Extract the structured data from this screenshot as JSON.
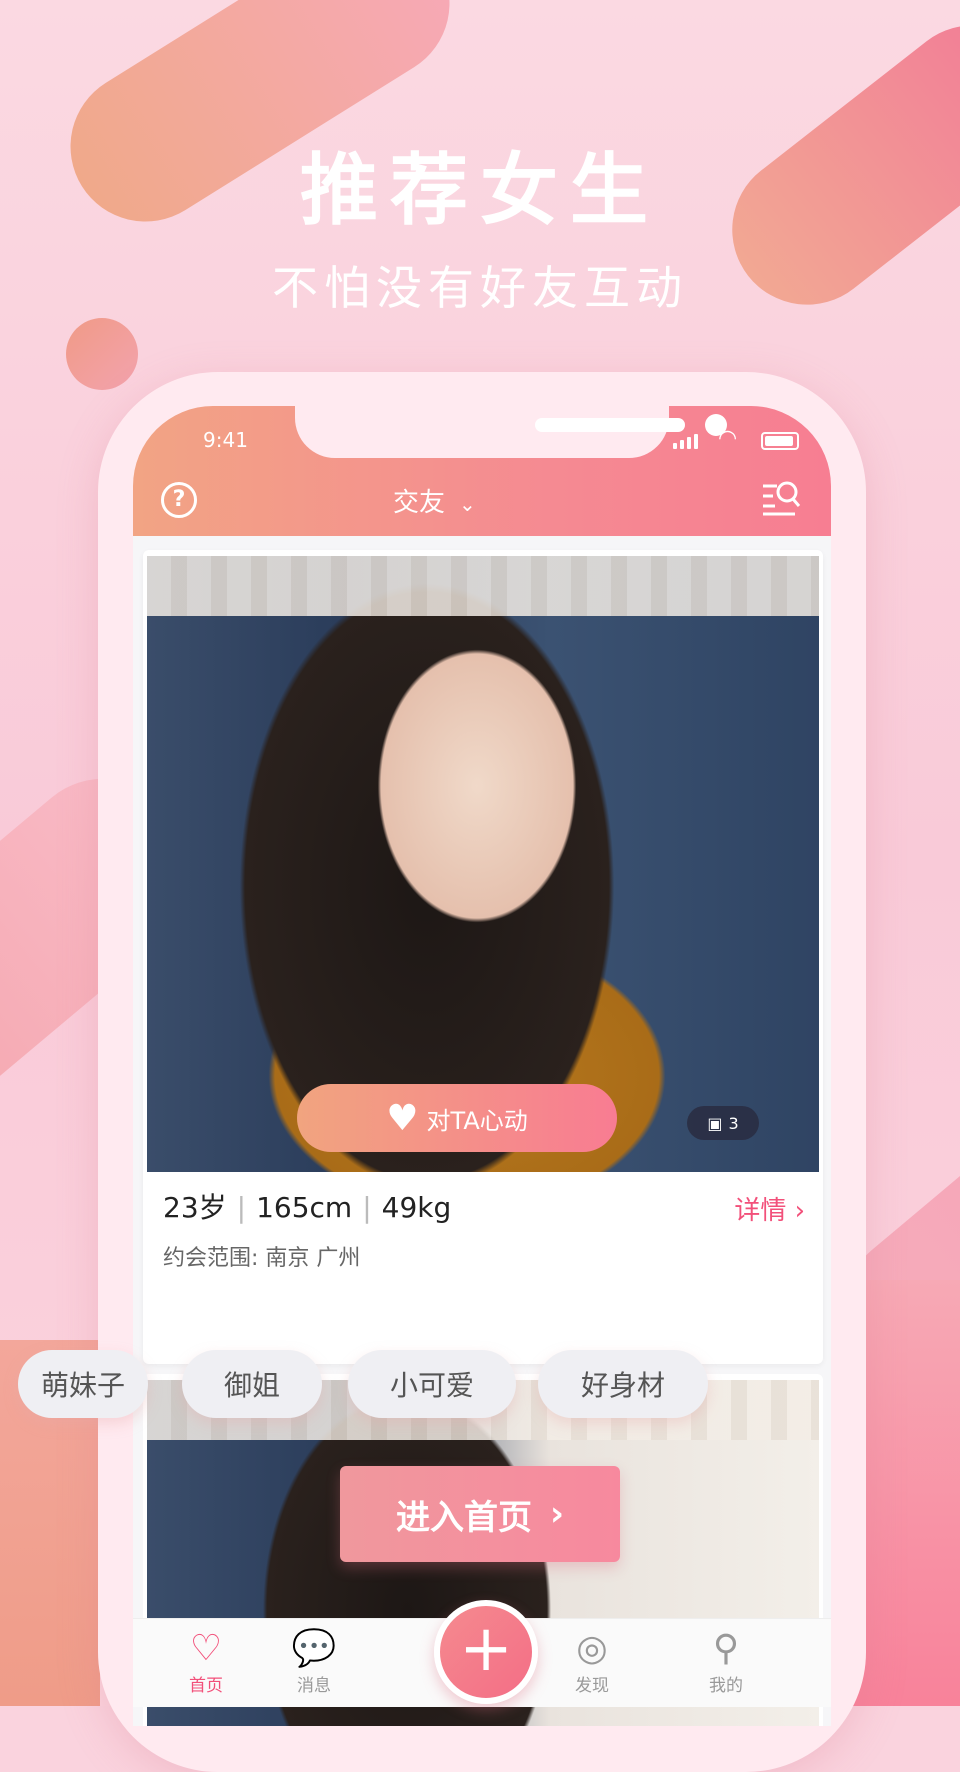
{
  "promo": {
    "headline": "推荐女生",
    "subheadline": "不怕没有好友互动"
  },
  "status_bar": {
    "time": "9:41"
  },
  "nav": {
    "title": "交友",
    "help_icon": "question-circle-icon",
    "filter_icon": "search-filter-icon"
  },
  "card": {
    "age": "23岁",
    "height": "165cm",
    "weight": "49kg",
    "detail_label": "详情",
    "range_label": "约会范围:",
    "range_value": "南京 广州",
    "like_label": "对TA心动",
    "photo_count": "3"
  },
  "tags": [
    "萌妹子",
    "御姐",
    "小可爱",
    "好身材"
  ],
  "enter_button": "进入首页",
  "tabbar": {
    "tabs": [
      {
        "label": "首页",
        "icon": "heart-icon",
        "active": true
      },
      {
        "label": "消息",
        "icon": "chat-icon",
        "active": false
      },
      {
        "label": "发现",
        "icon": "discover-icon",
        "active": false
      },
      {
        "label": "我的",
        "icon": "profile-icon",
        "active": false
      }
    ],
    "center_icon": "plus-icon"
  },
  "colors": {
    "accent": "#f2507a",
    "gradient_start": "#f2a484",
    "gradient_end": "#f77e92"
  }
}
